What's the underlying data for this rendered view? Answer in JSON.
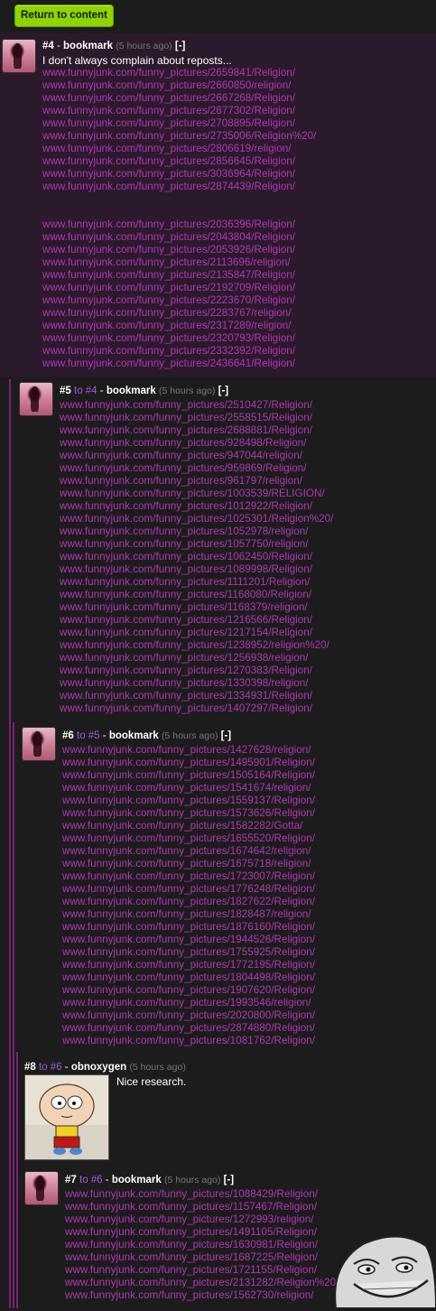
{
  "toolbar": {
    "return_label": "Return to content"
  },
  "comments": [
    {
      "num": "#4",
      "to": "",
      "user": "bookmark",
      "time": "(5 hours ago)",
      "collapse": "[-]",
      "text": "I don't always complain about reposts...",
      "links_a": [
        "www.funnyjunk.com/funny_pictures/2659841/Religion/",
        "www.funnyjunk.com/funny_pictures/2660850/religion/",
        "www.funnyjunk.com/funny_pictures/2667268/Religion/",
        "www.funnyjunk.com/funny_pictures/2677302/Religion/",
        "www.funnyjunk.com/funny_pictures/2708895/Religion/",
        "www.funnyjunk.com/funny_pictures/2735006/Religion%20/",
        "www.funnyjunk.com/funny_pictures/2806619/religion/",
        "www.funnyjunk.com/funny_pictures/2856645/Religion/",
        "www.funnyjunk.com/funny_pictures/3036964/Religion/",
        "www.funnyjunk.com/funny_pictures/2874439/Religion/"
      ],
      "links_b": [
        "www.funnyjunk.com/funny_pictures/2036396/Religion/",
        "www.funnyjunk.com/funny_pictures/2043804/Religion/",
        "www.funnyjunk.com/funny_pictures/2053926/Religion/",
        "www.funnyjunk.com/funny_pictures/2113696/religion/",
        "www.funnyjunk.com/funny_pictures/2135847/Religion/",
        "www.funnyjunk.com/funny_pictures/2192709/Religion/",
        "www.funnyjunk.com/funny_pictures/2223670/Religion/",
        "www.funnyjunk.com/funny_pictures/2283767/religion/",
        "www.funnyjunk.com/funny_pictures/2317289/religion/",
        "www.funnyjunk.com/funny_pictures/2320793/Religion/",
        "www.funnyjunk.com/funny_pictures/2332392/Religion/",
        "www.funnyjunk.com/funny_pictures/2436641/Religion/"
      ]
    },
    {
      "num": "#5",
      "to": "to #4",
      "user": "bookmark",
      "time": "(5 hours ago)",
      "collapse": "[-]",
      "links": [
        "www.funnyjunk.com/funny_pictures/2510427/Religion/",
        "www.funnyjunk.com/funny_pictures/2558515/Religion/",
        "www.funnyjunk.com/funny_pictures/2688881/Religion/",
        "www.funnyjunk.com/funny_pictures/928498/Religion/",
        "www.funnyjunk.com/funny_pictures/947044/religion/",
        "www.funnyjunk.com/funny_pictures/959869/Religion/",
        "www.funnyjunk.com/funny_pictures/961797/religion/",
        "www.funnyjunk.com/funny_pictures/1003539/RELIGION/",
        "www.funnyjunk.com/funny_pictures/1012922/Religion/",
        "www.funnyjunk.com/funny_pictures/1025301/Religion%20/",
        "www.funnyjunk.com/funny_pictures/1052978/religion/",
        "www.funnyjunk.com/funny_pictures/1057750/religion/",
        "www.funnyjunk.com/funny_pictures/1062450/Religion/",
        "www.funnyjunk.com/funny_pictures/1089998/Religion/",
        "www.funnyjunk.com/funny_pictures/1111201/Religion/",
        "www.funnyjunk.com/funny_pictures/1168080/Religion/",
        "www.funnyjunk.com/funny_pictures/1168379/religion/",
        "www.funnyjunk.com/funny_pictures/1216566/Religion/",
        "www.funnyjunk.com/funny_pictures/1217154/Religion/",
        "www.funnyjunk.com/funny_pictures/1238952/religion%20/",
        "www.funnyjunk.com/funny_pictures/1256938/religion/",
        "www.funnyjunk.com/funny_pictures/1270383/Religion/",
        "www.funnyjunk.com/funny_pictures/1330398/religion/",
        "www.funnyjunk.com/funny_pictures/1334931/Religion/",
        "www.funnyjunk.com/funny_pictures/1407297/Religion/"
      ]
    },
    {
      "num": "#6",
      "to": "to #5",
      "user": "bookmark",
      "time": "(5 hours ago)",
      "collapse": "[-]",
      "links": [
        "www.funnyjunk.com/funny_pictures/1427628/religion/",
        "www.funnyjunk.com/funny_pictures/1495901/Religion/",
        "www.funnyjunk.com/funny_pictures/1505164/Religion/",
        "www.funnyjunk.com/funny_pictures/1541674/religion/",
        "www.funnyjunk.com/funny_pictures/1559137/Religion/",
        "www.funnyjunk.com/funny_pictures/1573626/Religion/",
        "www.funnyjunk.com/funny_pictures/1582282/Gotta/",
        "www.funnyjunk.com/funny_pictures/1655520/Religion/",
        "www.funnyjunk.com/funny_pictures/1674642/religion/",
        "www.funnyjunk.com/funny_pictures/1675718/religion/",
        "www.funnyjunk.com/funny_pictures/1723007/Religion/",
        "www.funnyjunk.com/funny_pictures/1776248/Religion/",
        "www.funnyjunk.com/funny_pictures/1827622/Religion/",
        "www.funnyjunk.com/funny_pictures/1828487/religion/",
        "www.funnyjunk.com/funny_pictures/1876160/Religion/",
        "www.funnyjunk.com/funny_pictures/1944526/Religion/",
        "www.funnyjunk.com/funny_pictures/1755925/Religion/",
        "www.funnyjunk.com/funny_pictures/1772195/Religion/",
        "www.funnyjunk.com/funny_pictures/1804498/Religion/",
        "www.funnyjunk.com/funny_pictures/1907620/Religion/",
        "www.funnyjunk.com/funny_pictures/1993546/religion/",
        "www.funnyjunk.com/funny_pictures/2020800/Religion/",
        "www.funnyjunk.com/funny_pictures/2874880/Religion/",
        "www.funnyjunk.com/funny_pictures/1081762/Religion/"
      ]
    },
    {
      "num": "#8",
      "to": "to #6",
      "user": "obnoxygen",
      "time": "(5 hours ago)",
      "text": "Nice research."
    },
    {
      "num": "#7",
      "to": "to #6",
      "user": "bookmark",
      "time": "(5 hours ago)",
      "collapse": "[-]",
      "links": [
        "www.funnyjunk.com/funny_pictures/1088429/Religion/",
        "www.funnyjunk.com/funny_pictures/1157467/Religion/",
        "www.funnyjunk.com/funny_pictures/1272993/religion/",
        "www.funnyjunk.com/funny_pictures/1491105/Religion/",
        "www.funnyjunk.com/funny_pictures/1630981/Religion/",
        "www.funnyjunk.com/funny_pictures/1687225/Religion/",
        "www.funnyjunk.com/funny_pictures/1721155/Religion/",
        "www.funnyjunk.com/funny_pictures/2131282/Religion%20/",
        "www.funnyjunk.com/funny_pictures/1562730/religion/"
      ]
    }
  ],
  "colors": {
    "link": "#b036b6",
    "to_link": "#a05ae0",
    "button": "#8fd400",
    "thread_line": "#7b1f7b",
    "highlight_bg": "#2b1a2b"
  }
}
